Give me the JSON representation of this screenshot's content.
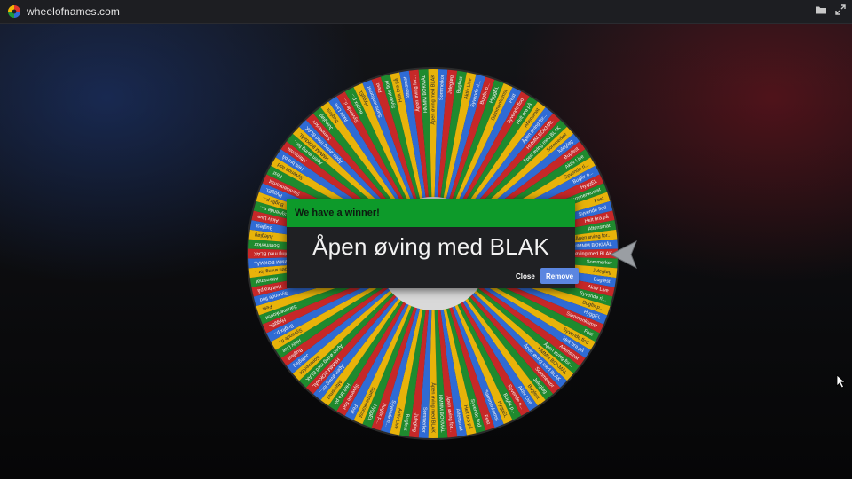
{
  "header": {
    "site_name": "wheelofnames.com",
    "icons": [
      "colorwheel-logo-icon",
      "folder-icon",
      "expand-icon"
    ]
  },
  "wheel": {
    "segment_colors": [
      "#c62828",
      "#1f8a2e",
      "#e8b30a",
      "#2f6bd4"
    ],
    "visible_entries": [
      "Åpen øving med BLAK",
      "Sommerkor",
      "Julegløg",
      "Bugfest",
      "Aktiv Live",
      "Syvende ri...",
      "Bugfix p...",
      "HyggEL",
      "Sammenkomst",
      "Fest",
      "Syvende flod",
      "Helt bra på",
      "Aftensmat",
      "Åpen øving for...",
      "HMMM BOKMÅL"
    ]
  },
  "dialog": {
    "title": "We have a winner!",
    "winner": "Åpen øving med BLAK",
    "close_label": "Close",
    "remove_label": "Remove",
    "header_color": "#0d9a2a",
    "remove_color": "#5b86e0"
  }
}
